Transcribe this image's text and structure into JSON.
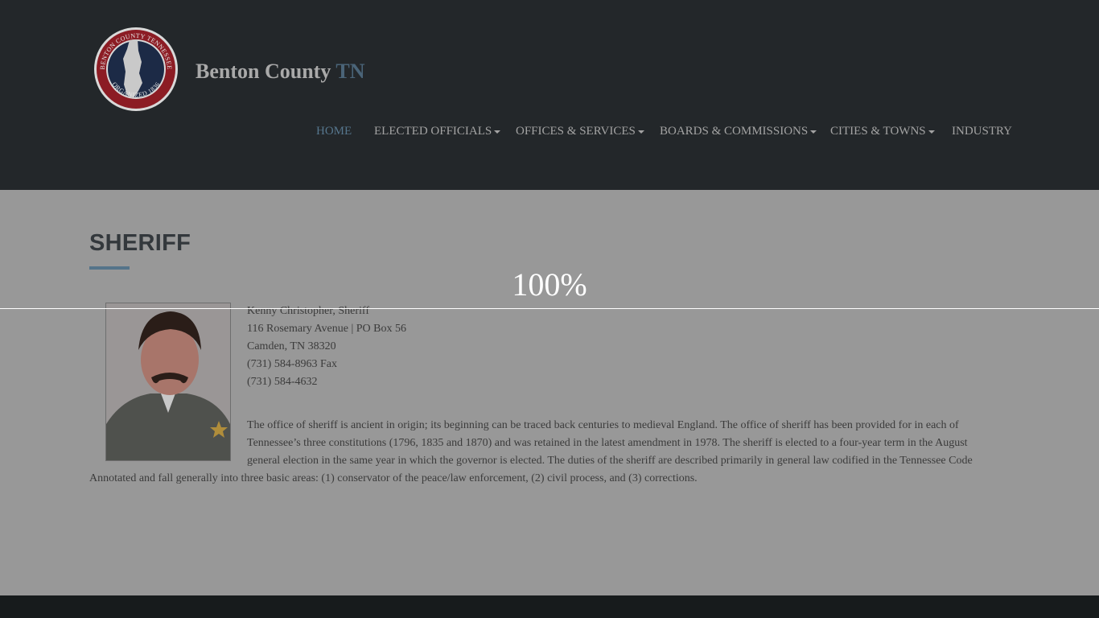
{
  "site": {
    "title_main": "Benton County",
    "title_accent": "TN",
    "seal_top_text": "BENTON COUNTY TENNESSEE",
    "seal_bottom_text": "ORGANIZED 1836"
  },
  "nav": {
    "items": [
      {
        "label": "HOME",
        "active": true,
        "dropdown": false
      },
      {
        "label": "ELECTED OFFICIALS",
        "active": false,
        "dropdown": true
      },
      {
        "label": "OFFICES & SERVICES",
        "active": false,
        "dropdown": true
      },
      {
        "label": "BOARDS & COMMISSIONS",
        "active": false,
        "dropdown": true
      },
      {
        "label": "CITIES & TOWNS",
        "active": false,
        "dropdown": true
      },
      {
        "label": "INDUSTRY",
        "active": false,
        "dropdown": false
      }
    ]
  },
  "main": {
    "page_title": "SHERIFF",
    "contact": {
      "name": "Kenny Christopher, Sheriff",
      "address": "116 Rosemary Avenue | PO Box 56",
      "city": "Camden, TN 38320",
      "fax": "(731) 584-8963 Fax",
      "phone": "(731) 584-4632"
    },
    "description": "The office of sheriff is ancient in origin; its beginning can be traced back centuries to medieval England. The office of sheriff has been provided for in each of Tennessee’s three constitutions (1796, 1835 and 1870) and was retained in the latest amendment in 1978. The sheriff is elected to a four-year term in the August general election in the same year in which the governor is elected. The duties of the sheriff are described primarily in general law codified in the Tennessee Code Annotated and fall generally into three basic areas: (1) conservator of the peace/law enforcement, (2) civil process, and (3) corrections."
  },
  "overlay": {
    "zoom_label": "100%"
  },
  "colors": {
    "header_bg": "#23272a",
    "page_bg": "#989898",
    "accent": "#55748a",
    "footer_bg": "#171b1c"
  }
}
